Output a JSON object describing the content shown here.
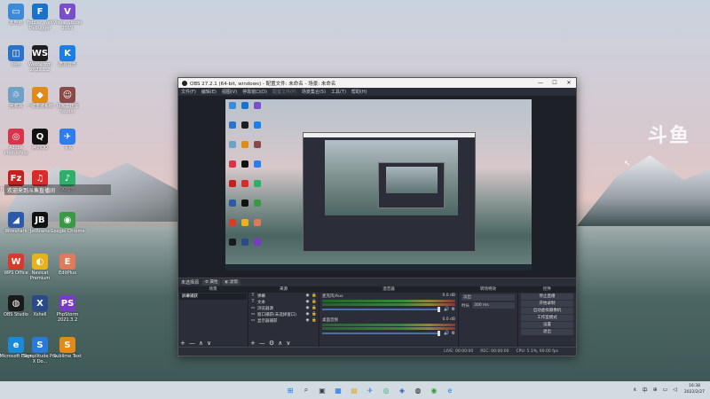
{
  "desktop": {
    "icons": [
      {
        "label": "此电脑",
        "color": "#3b8bd8",
        "glyph": "▭"
      },
      {
        "label": "Fiddler Web Debugger",
        "color": "#1a73c9",
        "glyph": "F"
      },
      {
        "label": "Visual Studio 2019",
        "color": "#7b4fc9",
        "glyph": "V"
      },
      {
        "label": "网络",
        "color": "#2a73c9",
        "glyph": "◫"
      },
      {
        "label": "WebStorm 2021.1.2",
        "color": "#1e1e1e",
        "glyph": "WS"
      },
      {
        "label": "酷狗音乐",
        "color": "#1a7fe6",
        "glyph": "K"
      },
      {
        "label": "回收站",
        "color": "#6ea0c8",
        "glyph": "♲"
      },
      {
        "label": "一键重装系统",
        "color": "#e08a1a",
        "glyph": "◆"
      },
      {
        "label": "极客工作室 Studio",
        "color": "#8a4a4a",
        "glyph": "☺"
      },
      {
        "label": "Adobe Photoshop",
        "color": "#d8344a",
        "glyph": "◎"
      },
      {
        "label": "腾讯QQ",
        "color": "#111111",
        "glyph": "Q"
      },
      {
        "label": "飞书",
        "color": "#2d7cf0",
        "glyph": "✈"
      },
      {
        "label": "FileZilla Client",
        "color": "#c4201d",
        "glyph": "Fz"
      },
      {
        "label": "网易云音乐",
        "color": "#d92b2b",
        "glyph": "♫"
      },
      {
        "label": "QQ音乐",
        "color": "#2fae6c",
        "glyph": "♪"
      },
      {
        "label": "Wireshark",
        "color": "#2d5aa8",
        "glyph": "◢"
      },
      {
        "label": "JetBrains",
        "color": "#111111",
        "glyph": "JB"
      },
      {
        "label": "Google Chrome",
        "color": "#3a9a43",
        "glyph": "◉"
      },
      {
        "label": "WPS Office",
        "color": "#d83b2a",
        "glyph": "W"
      },
      {
        "label": "Navicat Premium",
        "color": "#e6b41a",
        "glyph": "◐"
      },
      {
        "label": "EditPlus",
        "color": "#e07a5a",
        "glyph": "E"
      },
      {
        "label": "OBS Studio",
        "color": "#1a1a1a",
        "glyph": "◍"
      },
      {
        "label": "Xshell",
        "color": "#2a4a8a",
        "glyph": "X"
      },
      {
        "label": "PhpStorm 2021.3.2",
        "color": "#7a3ac8",
        "glyph": "PS"
      },
      {
        "label": "Microsoft Edge",
        "color": "#1a8ad8",
        "glyph": "e"
      },
      {
        "label": "Semplitude Pro X Do...",
        "color": "#2a7ad8",
        "glyph": "S"
      },
      {
        "label": "Sublime Text",
        "color": "#e08a1a",
        "glyph": "S"
      }
    ],
    "overlay_text": "欢迎来到斗鱼直播间",
    "watermark": "斗鱼",
    "cursor": "↖"
  },
  "obs": {
    "title": "OBS 27.2.1 (64-bit, windows) - 配置文件: 未命名 - 场景: 未命名",
    "window_controls": {
      "minimize": "—",
      "maximize": "☐",
      "close": "✕"
    },
    "menu": [
      {
        "label": "文件(F)",
        "enabled": true
      },
      {
        "label": "编辑(E)",
        "enabled": true
      },
      {
        "label": "视图(V)",
        "enabled": true
      },
      {
        "label": "停靠窗口(D)",
        "enabled": true
      },
      {
        "label": "配置文件(P)",
        "enabled": false
      },
      {
        "label": "场景集合(S)",
        "enabled": true
      },
      {
        "label": "工具(T)",
        "enabled": true
      },
      {
        "label": "帮助(H)",
        "enabled": true
      }
    ],
    "source_bar": {
      "no_source": "未选择源",
      "properties": "⚙ 属性",
      "filters": "◐ 滤镜"
    },
    "scenes": {
      "header": "场景",
      "items": [
        "屏幕捕获"
      ]
    },
    "sources": {
      "header": "来源",
      "items": [
        {
          "icon": "T",
          "label": "弹幕"
        },
        {
          "icon": "T",
          "label": "文本"
        },
        {
          "icon": "▭",
          "label": "浏览器源"
        },
        {
          "icon": "▭",
          "label": "窗口捕获(未选择窗口)"
        },
        {
          "icon": "▭",
          "label": "显示器捕获"
        }
      ]
    },
    "mixer": {
      "header": "混音器",
      "channels": [
        {
          "name": "麦克风/Aux",
          "db": "0.0 dB"
        },
        {
          "name": "桌面音频",
          "db": "0.0 dB"
        }
      ]
    },
    "transitions": {
      "header": "转场特效",
      "type": "淡出",
      "duration_label": "时长",
      "duration_value": "300 ms"
    },
    "controls": {
      "header": "控件",
      "buttons": [
        "停止直播",
        "开始录制",
        "启动虚拟摄像机",
        "工作室模式",
        "设置",
        "退出"
      ]
    },
    "dock_toolbar": {
      "add": "+",
      "remove": "—",
      "up": "∧",
      "down": "∨",
      "settings": "⚙"
    },
    "status": {
      "live": "LIVE: 00:00:00",
      "rec": "REC: 00:00:00",
      "cpu": "CPU: 5.1%, 60.00 fps"
    }
  },
  "taskbar": {
    "apps": [
      {
        "glyph": "⊞",
        "color": "#1a73e8"
      },
      {
        "glyph": "⌕",
        "color": "#333333"
      },
      {
        "glyph": "▣",
        "color": "#444444"
      },
      {
        "glyph": "▦",
        "color": "#1a73e8"
      },
      {
        "glyph": "▤",
        "color": "#e0a21a"
      },
      {
        "glyph": "✈",
        "color": "#2d7cf0"
      },
      {
        "glyph": "◎",
        "color": "#2fae6c"
      },
      {
        "glyph": "◈",
        "color": "#2d5aa8"
      },
      {
        "glyph": "◍",
        "color": "#111111"
      },
      {
        "glyph": "◉",
        "color": "#3a9a43"
      },
      {
        "glyph": "e",
        "color": "#1a8ad8"
      }
    ],
    "tray": [
      "∧",
      "中",
      "⊕",
      "▭",
      "◁"
    ],
    "time": "16:38",
    "date": "2022/2/27"
  }
}
